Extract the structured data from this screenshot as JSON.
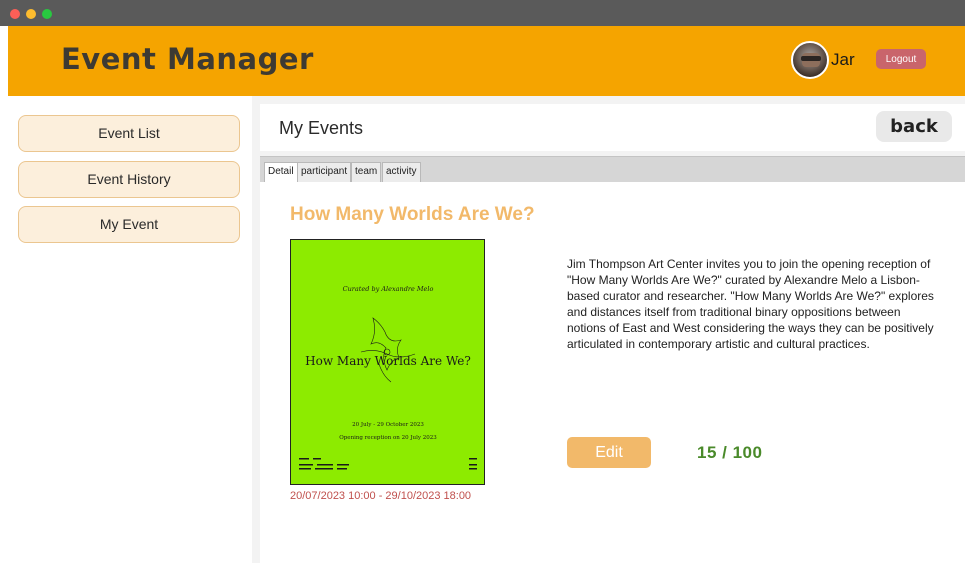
{
  "app": {
    "title": "Event Manager"
  },
  "user": {
    "name": "Jar",
    "logout_label": "Logout"
  },
  "sidebar": {
    "items": [
      {
        "label": "Event List"
      },
      {
        "label": "Event History"
      },
      {
        "label": "My Event"
      }
    ]
  },
  "page": {
    "title": "My Events",
    "back_label": "back"
  },
  "tabs": [
    {
      "label": "Detail",
      "active": true
    },
    {
      "label": "participant"
    },
    {
      "label": "team"
    },
    {
      "label": "activity"
    }
  ],
  "event": {
    "title": "How Many Worlds Are We?",
    "dates": "20/07/2023 10:00 - 29/10/2023 18:00",
    "description": "Jim Thompson Art Center invites you to join the opening reception of \"How Many Worlds Are We?\" curated by Alexandre Melo a Lisbon-based curator and researcher. \"How Many Worlds Are We?\" explores and distances itself from traditional binary oppositions between notions of East and West considering the ways they can be positively articulated in contemporary artistic and cultural practices.",
    "edit_label": "Edit",
    "capacity": "15 / 100",
    "poster": {
      "curator_line": "Curated by Alexandre Melo",
      "title_text": "How Many Worlds Are We?",
      "date_line": "20 July - 29 October 2023",
      "opening_line": "Opening reception on 20 July 2023",
      "background_color": "#8deb00"
    }
  },
  "colors": {
    "header": "#f5a400",
    "accent": "#f2b96a",
    "logout": "#c9656b",
    "dates": "#c0504d",
    "capacity": "#4a8a2a"
  }
}
